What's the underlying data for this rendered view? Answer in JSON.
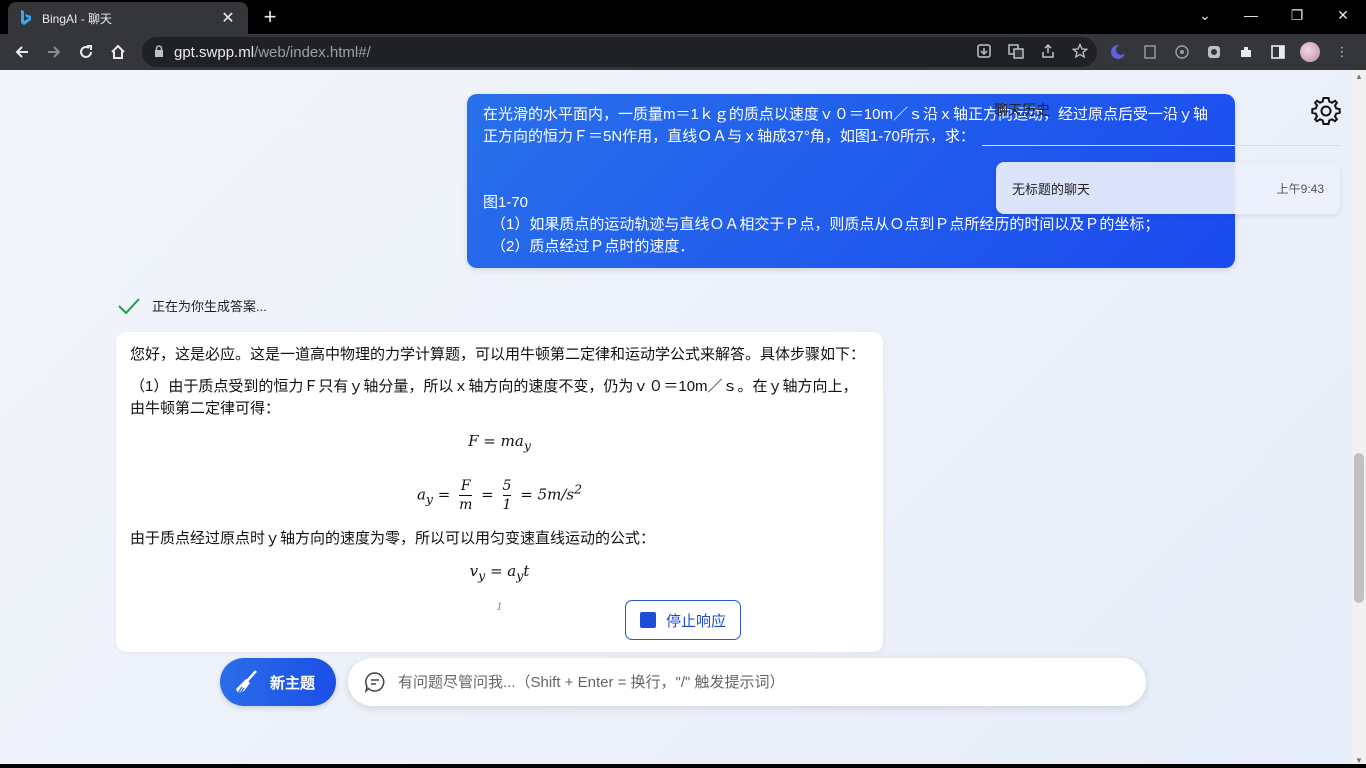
{
  "browser": {
    "tab_title": "BingAI - 聊天",
    "tab_close": "✕",
    "new_tab": "+",
    "url_host": "gpt.swpp.ml",
    "url_path": "/web/index.html#/",
    "window_controls": {
      "dropdown": "⌄",
      "minimize": "—",
      "restore": "❐",
      "close": "✕"
    },
    "icons": [
      "back-icon",
      "forward-icon",
      "reload-icon",
      "home-icon",
      "lock-icon",
      "download-icon",
      "translate-icon",
      "share-icon",
      "star-icon",
      "extensions-icon",
      "sidebar-icon",
      "avatar",
      "menu-icon"
    ]
  },
  "chat": {
    "user_message": {
      "line1": "在光滑的水平面内，一质量m＝1ｋｇ的质点以速度ｖ０＝10m／ｓ沿ｘ轴正方向运动，经过原点后受一沿ｙ轴正方向的恒力Ｆ＝5N作用，直线ＯＡ与ｘ轴成37°角，如图1-70所示，求：",
      "line2": "图1-70",
      "line3": "（1）如果质点的运动轨迹与直线ＯＡ相交于Ｐ点，则质点从Ｏ点到Ｐ点所经历的时间以及Ｐ的坐标；",
      "line4": "（2）质点经过Ｐ点时的速度．"
    },
    "status": "正在为你生成答案...",
    "answer": {
      "p1": "您好，这是必应。这是一道高中物理的力学计算题，可以用牛顿第二定律和运动学公式来解答。具体步骤如下：",
      "p2": "（1）由于质点受到的恒力Ｆ只有ｙ轴分量，所以ｘ轴方向的速度不变，仍为ｖ０＝10m／ｓ。在ｙ轴方向上，由牛顿第二定律可得：",
      "f1": "F = ma",
      "f1_sub": "y",
      "f2_lhs": "a",
      "f2_lhs_sub": "y",
      "f2_eq": "=",
      "f2_num1": "F",
      "f2_den1": "m",
      "f2_num2": "5",
      "f2_den2": "1",
      "f2_rhs": "= 5m/s",
      "f2_rhs_sup": "2",
      "p3": "由于质点经过原点时ｙ轴方向的速度为零，所以可以用匀变速直线运动的公式：",
      "f3_lhs": "v",
      "f3_lhs_sub": "y",
      "f3_rhs": "= a",
      "f3_rhs_sub": "y",
      "f3_tail": "t",
      "f4_partial": "1"
    },
    "stop_button": "停止响应",
    "new_topic_button": "新主题",
    "input_placeholder": "有问题尽管问我...（Shift + Enter = 换行，\"/\" 触发提示词）"
  },
  "history": {
    "title": "聊天历史",
    "items": [
      {
        "title": "无标题的聊天",
        "time": "上午9:43"
      }
    ]
  },
  "colors": {
    "accent": "#1b4aef",
    "bubble_start": "#2870ea",
    "check": "#1f9d55"
  }
}
